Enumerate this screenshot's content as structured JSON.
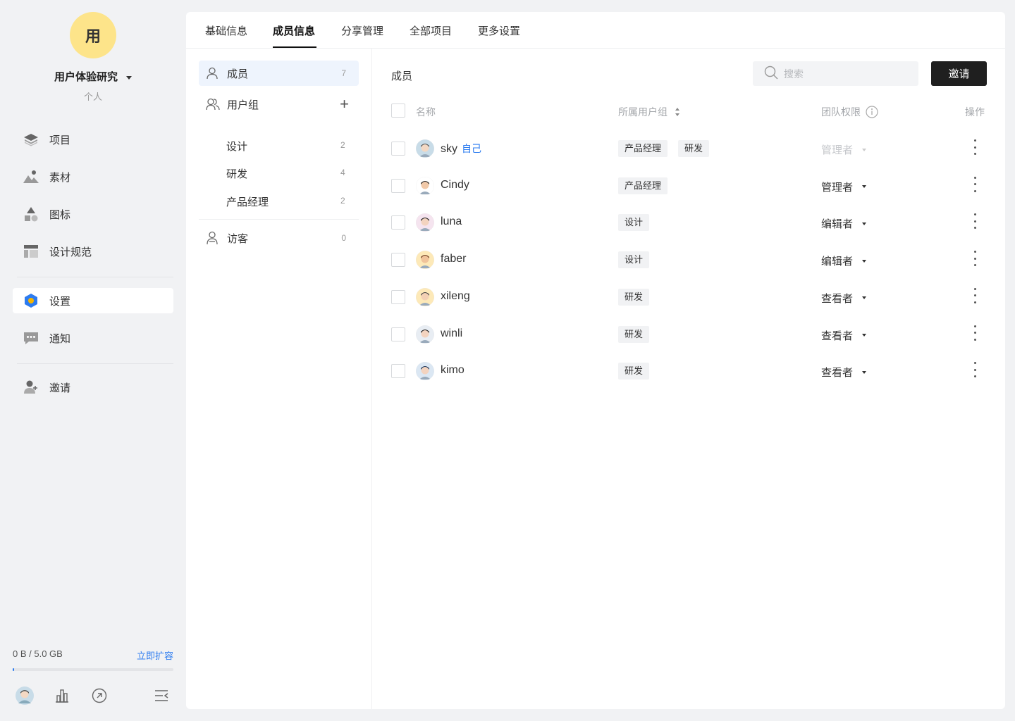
{
  "workspace": {
    "avatar_char": "用",
    "name": "用户体验研究",
    "type": "个人",
    "avatar_color": "#fde48a"
  },
  "nav": [
    {
      "label": "项目",
      "icon": "layers-icon"
    },
    {
      "label": "素材",
      "icon": "image-icon"
    },
    {
      "label": "图标",
      "icon": "shapes-icon"
    },
    {
      "label": "设计规范",
      "icon": "layout-icon"
    },
    {
      "label": "设置",
      "icon": "settings-hex-icon",
      "active": true
    },
    {
      "label": "通知",
      "icon": "chat-icon"
    },
    {
      "label": "邀请",
      "icon": "add-user-icon"
    }
  ],
  "storage": {
    "text": "0 B / 5.0 GB",
    "link": "立即扩容",
    "used_fraction": 0.01
  },
  "tabs": [
    "基础信息",
    "成员信息",
    "分享管理",
    "全部项目",
    "更多设置"
  ],
  "active_tab": 1,
  "groups": {
    "members": {
      "label": "成员",
      "count": "7"
    },
    "user_groups": {
      "label": "用户组",
      "add": "+"
    },
    "subgroups": [
      {
        "label": "设计",
        "count": "2"
      },
      {
        "label": "研发",
        "count": "4"
      },
      {
        "label": "产品经理",
        "count": "2"
      }
    ],
    "guests": {
      "label": "访客",
      "count": "0"
    }
  },
  "content": {
    "title": "成员",
    "search_placeholder": "搜索",
    "invite_label": "邀请",
    "headers": {
      "name": "名称",
      "group": "所属用户组",
      "role": "团队权限",
      "action": "操作"
    }
  },
  "members": [
    {
      "name": "sky",
      "self": "自己",
      "groups": [
        "产品经理",
        "研发"
      ],
      "role": "管理者",
      "role_disabled": true
    },
    {
      "name": "Cindy",
      "groups": [
        "产品经理"
      ],
      "role": "管理者"
    },
    {
      "name": "luna",
      "groups": [
        "设计"
      ],
      "role": "编辑者"
    },
    {
      "name": "faber",
      "groups": [
        "设计"
      ],
      "role": "编辑者"
    },
    {
      "name": "xileng",
      "groups": [
        "研发"
      ],
      "role": "查看者"
    },
    {
      "name": "winli",
      "groups": [
        "研发"
      ],
      "role": "查看者"
    },
    {
      "name": "kimo",
      "groups": [
        "研发"
      ],
      "role": "查看者"
    }
  ],
  "colors": {
    "accent": "#2d7cf0",
    "dark_button": "#1f1f1f",
    "active_group_bg": "#eef4fd"
  }
}
